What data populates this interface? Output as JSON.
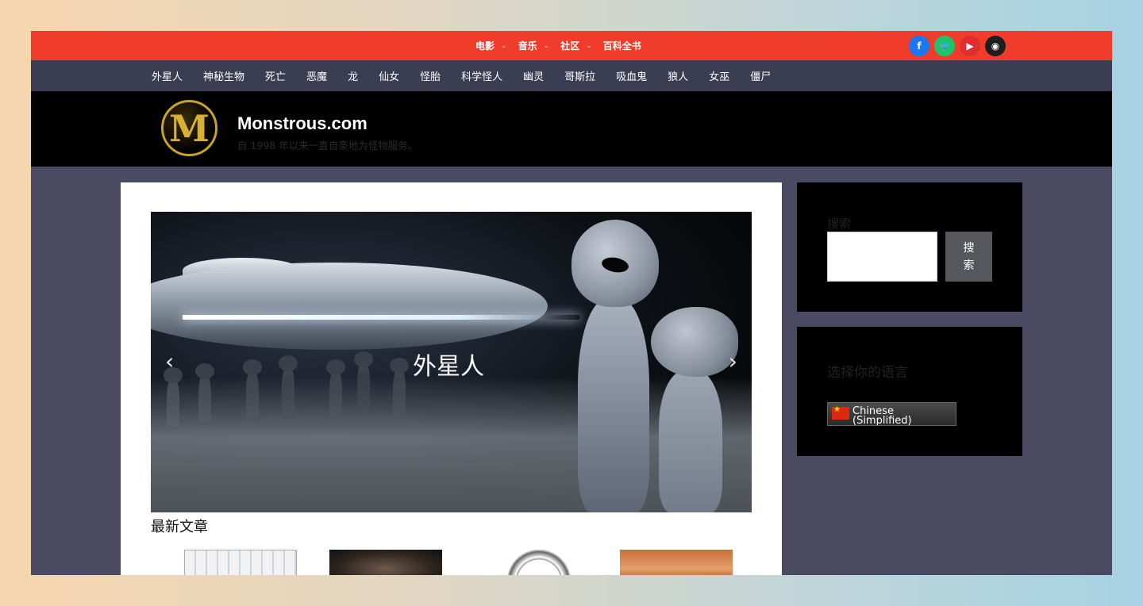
{
  "top_menu": [
    {
      "label": "电影",
      "has_dropdown": true
    },
    {
      "label": "音乐",
      "has_dropdown": true
    },
    {
      "label": "社区",
      "has_dropdown": true
    },
    {
      "label": "百科全书",
      "has_dropdown": false
    }
  ],
  "social": [
    {
      "name": "facebook-icon",
      "glyph": "f",
      "color": "#1877f2"
    },
    {
      "name": "twitter-icon",
      "glyph": "🐦",
      "color": "#1cc46b"
    },
    {
      "name": "youtube-icon",
      "glyph": "▶",
      "color": "#e02d2d"
    },
    {
      "name": "discord-icon",
      "glyph": "◉",
      "color": "#1e1e1e"
    }
  ],
  "categories": [
    "外星人",
    "神秘生物",
    "死亡",
    "恶魔",
    "龙",
    "仙女",
    "怪胎",
    "科学怪人",
    "幽灵",
    "哥斯拉",
    "吸血鬼",
    "狼人",
    "女巫",
    "僵尸"
  ],
  "header": {
    "logo_letter": "M",
    "site_title": "Monstrous.com",
    "tagline": "自 1998 年以来一直自豪地为怪物服务。"
  },
  "slider": {
    "caption": "外星人",
    "prev": "‹",
    "next": "›"
  },
  "latest": {
    "title": "最新文章"
  },
  "search_widget": {
    "title": "搜索",
    "button_label": "搜索",
    "input_value": ""
  },
  "lang_widget": {
    "title": "选择你的语言",
    "selected": "Chinese (Simplified)"
  },
  "colors": {
    "topbar": "#f03c2b",
    "nav": "#3b3d53",
    "page_bg": "#4a4b63",
    "header": "#000000"
  }
}
